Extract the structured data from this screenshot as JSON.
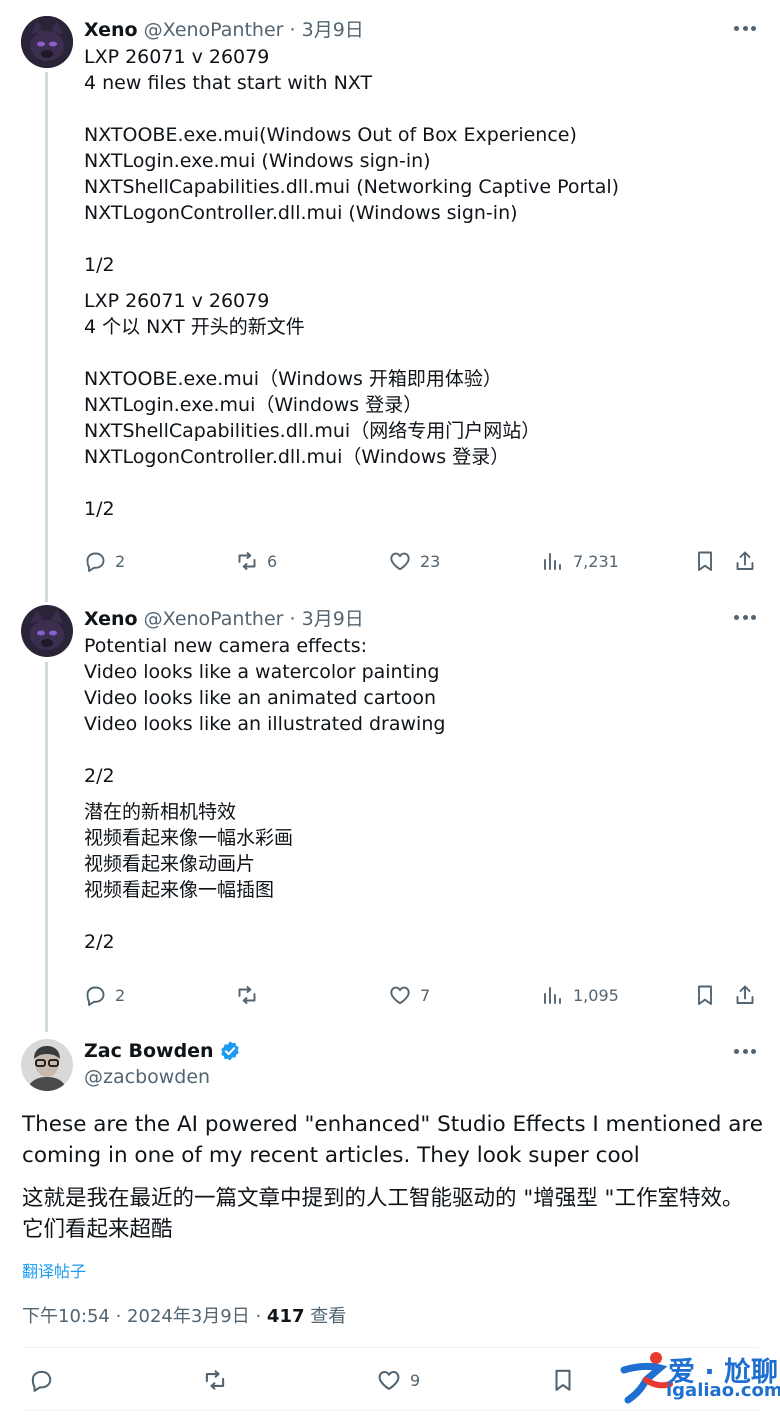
{
  "tweets": [
    {
      "name": "Xeno",
      "handle": "@XenoPanther",
      "dot": "·",
      "date": "3月9日",
      "text": "LXP 26071 v 26079\n4 new files that start with NXT\n\nNXTOOBE.exe.mui(Windows Out of Box Experience)\nNXTLogin.exe.mui (Windows sign-in)\nNXTShellCapabilities.dll.mui (Networking Captive Portal)\nNXTLogonController.dll.mui (Windows sign-in)\n\n1/2",
      "translation": "LXP 26071 v 26079\n4 个以 NXT 开头的新文件\n\nNXTOOBE.exe.mui（Windows 开箱即用体验）\nNXTLogin.exe.mui（Windows 登录）\nNXTShellCapabilities.dll.mui（网络专用门户网站）\nNXTLogonController.dll.mui（Windows 登录）\n\n1/2",
      "replies": "2",
      "retweets": "6",
      "likes": "23",
      "views": "7,231"
    },
    {
      "name": "Xeno",
      "handle": "@XenoPanther",
      "dot": "·",
      "date": "3月9日",
      "text": "Potential new camera effects:\nVideo looks like a watercolor painting\nVideo looks like an animated cartoon\nVideo looks like an illustrated drawing\n\n2/2",
      "translation": "潜在的新相机特效\n视频看起来像一幅水彩画\n视频看起来像动画片\n视频看起来像一幅插图\n\n2/2",
      "replies": "2",
      "retweets": "",
      "likes": "7",
      "views": "1,095"
    }
  ],
  "main": {
    "name": "Zac Bowden",
    "handle": "@zacbowden",
    "text": "These are the AI powered \"enhanced\" Studio Effects I mentioned are\ncoming in one of my recent articles. They look super cool",
    "translation": "这就是我在最近的一篇文章中提到的人工智能驱动的 \"增强型 \"工作室特效。\n它们看起来超酷",
    "translate_link": "翻译帖子",
    "time": "下午10:54 · 2024年3月9日 · ",
    "views_count": "417",
    "views_label": " 查看",
    "likes": "9"
  },
  "watermark": {
    "line1": "爱 · 尬聊",
    "line2": "igaliao.com"
  },
  "colors": {
    "text": "#0f1419",
    "secondary": "#536471",
    "link": "#1d9bf0",
    "verified": "#1d9bf0",
    "thread_line": "#cfd9de"
  },
  "icons": [
    "reply-icon",
    "retweet-icon",
    "like-icon",
    "views-icon",
    "bookmark-icon",
    "share-icon",
    "more-icon",
    "verified-badge-icon"
  ]
}
